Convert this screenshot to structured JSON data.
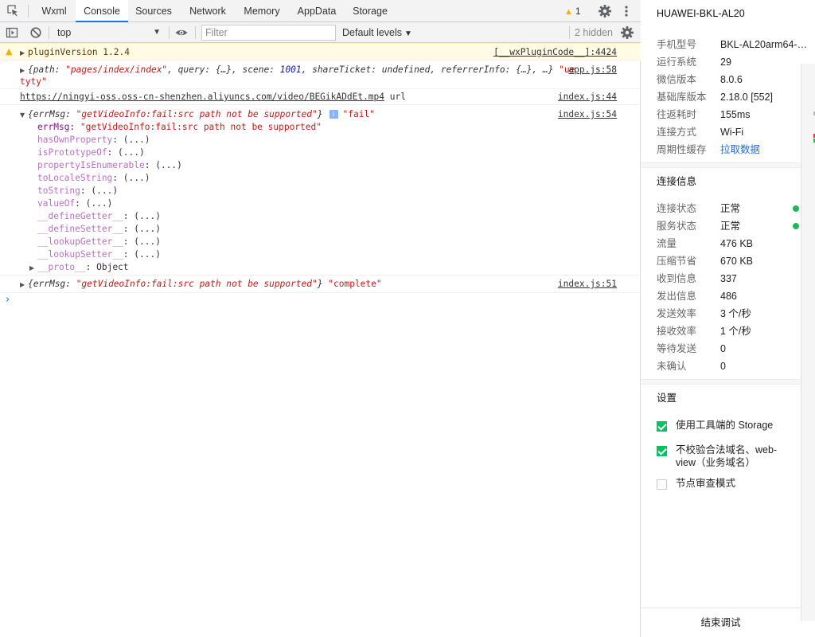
{
  "devtools": {
    "tabs": [
      {
        "label": "Wxml",
        "active": false
      },
      {
        "label": "Console",
        "active": true
      },
      {
        "label": "Sources",
        "active": false
      },
      {
        "label": "Network",
        "active": false
      },
      {
        "label": "Memory",
        "active": false
      },
      {
        "label": "AppData",
        "active": false
      },
      {
        "label": "Storage",
        "active": false
      }
    ],
    "warning_count": "1",
    "toolbar": {
      "context": "top",
      "filter_placeholder": "Filter",
      "filter_value": "",
      "levels_label": "Default levels",
      "hidden_label": "2 hidden"
    },
    "messages": {
      "plugin": {
        "text": "pluginVersion 1.2.4",
        "source": "[__wxPluginCode__]:4424"
      },
      "app": {
        "path_key": "path",
        "path_val": "\"pages/index/index\"",
        "query_key": "query",
        "query_val": "{…}",
        "scene_key": "scene",
        "scene_val": "1001",
        "share_key": "shareTicket",
        "share_val": "undefined",
        "ref_key": "referrerInfo",
        "ref_val": "{…}",
        "tail": "…}",
        "str_start": "\"ue",
        "str_end": "tyty\"",
        "source": "app.js:58"
      },
      "url": {
        "link": "https://ningyi-oss.oss-cn-shenzhen.aliyuncs.com/video/BEGikADdEt.mp4",
        "suffix": "url",
        "source": "index.js:44"
      },
      "fail": {
        "key": "errMsg",
        "val": "\"getVideoInfo:fail:src path not be supported\"",
        "badge": "i",
        "label": "\"fail\"",
        "source": "index.js:54",
        "props": [
          {
            "name": "errMsg",
            "value": "\"getVideoInfo:fail:src path not be supported\""
          },
          {
            "name": "hasOwnProperty",
            "value": "(...)"
          },
          {
            "name": "isPrototypeOf",
            "value": "(...)"
          },
          {
            "name": "propertyIsEnumerable",
            "value": "(...)"
          },
          {
            "name": "toLocaleString",
            "value": "(...)"
          },
          {
            "name": "toString",
            "value": "(...)"
          },
          {
            "name": "valueOf",
            "value": "(...)"
          },
          {
            "name": "__defineGetter__",
            "value": "(...)"
          },
          {
            "name": "__defineSetter__",
            "value": "(...)"
          },
          {
            "name": "__lookupGetter__",
            "value": "(...)"
          },
          {
            "name": "__lookupSetter__",
            "value": "(...)"
          },
          {
            "name": "__proto__",
            "value": "Object"
          }
        ]
      },
      "complete": {
        "key": "errMsg",
        "val": "\"getVideoInfo:fail:src path not be supported\"",
        "label": "\"complete\"",
        "source": "index.js:51"
      },
      "prompt": "›"
    }
  },
  "side": {
    "device": "HUAWEI-BKL-AL20",
    "info": [
      {
        "label": "手机型号",
        "value": "BKL-AL20arm64-…"
      },
      {
        "label": "运行系统",
        "value": "29"
      },
      {
        "label": "微信版本",
        "value": "8.0.6"
      },
      {
        "label": "基础库版本",
        "value": "2.18.0 [552]"
      },
      {
        "label": "往返耗时",
        "value": "155ms"
      },
      {
        "label": "连接方式",
        "value": "Wi-Fi"
      },
      {
        "label": "周期性缓存",
        "value": "拉取数据"
      }
    ],
    "connection_title": "连接信息",
    "connection": [
      {
        "label": "连接状态",
        "value": "正常"
      },
      {
        "label": "服务状态",
        "value": "正常"
      },
      {
        "label": "流量",
        "value": "476 KB"
      },
      {
        "label": "压缩节省",
        "value": "670 KB"
      },
      {
        "label": "收到信息",
        "value": "337"
      },
      {
        "label": "发出信息",
        "value": "486"
      },
      {
        "label": "发送效率",
        "value": "3 个/秒"
      },
      {
        "label": "接收效率",
        "value": "1 个/秒"
      },
      {
        "label": "等待发送",
        "value": "0"
      },
      {
        "label": "未确认",
        "value": "0"
      }
    ],
    "settings_title": "设置",
    "settings": [
      {
        "label": "使用工具端的 Storage",
        "checked": true
      },
      {
        "label": "不校验合法域名、web-view（业务域名）",
        "checked": true
      },
      {
        "label": "节点审查模式",
        "checked": false
      }
    ],
    "end_button": "结束调试",
    "status_color": "#1db954",
    "check_color": "#07c160",
    "link_color": "#1d6ed8"
  }
}
